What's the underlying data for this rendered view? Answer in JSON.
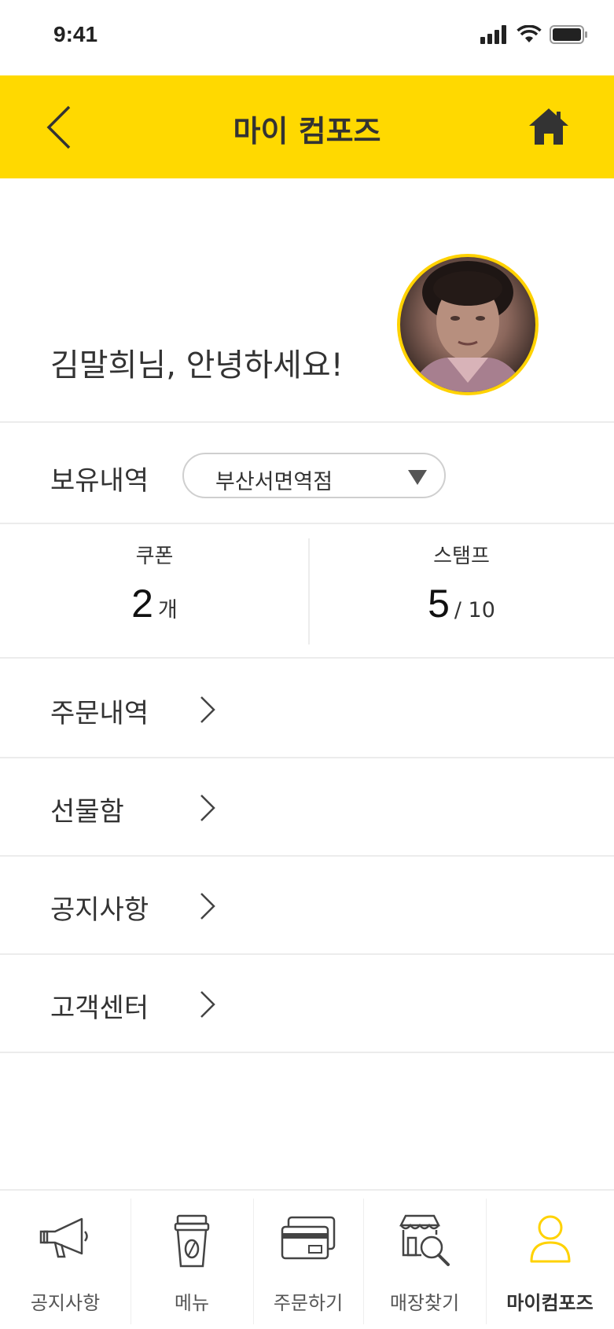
{
  "status_bar": {
    "time": "9:41"
  },
  "header": {
    "title": "마이 컴포즈"
  },
  "greeting": {
    "text": "김말희님, 안녕하세요!"
  },
  "holdings": {
    "label": "보유내역",
    "selected_store": "부산서면역점"
  },
  "counts": {
    "coupon": {
      "label": "쿠폰",
      "value": "2",
      "unit": "개"
    },
    "stamp": {
      "label": "스탬프",
      "value": "5",
      "total": "/ 10"
    }
  },
  "menu": {
    "items": [
      {
        "label": "주문내역"
      },
      {
        "label": "선물함"
      },
      {
        "label": "공지사항"
      },
      {
        "label": "고객센터"
      }
    ]
  },
  "tabs": {
    "items": [
      {
        "label": "공지사항",
        "icon": "megaphone-icon"
      },
      {
        "label": "메뉴",
        "icon": "coffee-cup-icon"
      },
      {
        "label": "주문하기",
        "icon": "card-icon"
      },
      {
        "label": "매장찾기",
        "icon": "store-search-icon"
      },
      {
        "label": "마이컴포즈",
        "icon": "person-icon",
        "active": true
      }
    ]
  },
  "colors": {
    "brand_yellow": "#FFD900",
    "text": "#333333",
    "divider": "#ECECEC"
  }
}
